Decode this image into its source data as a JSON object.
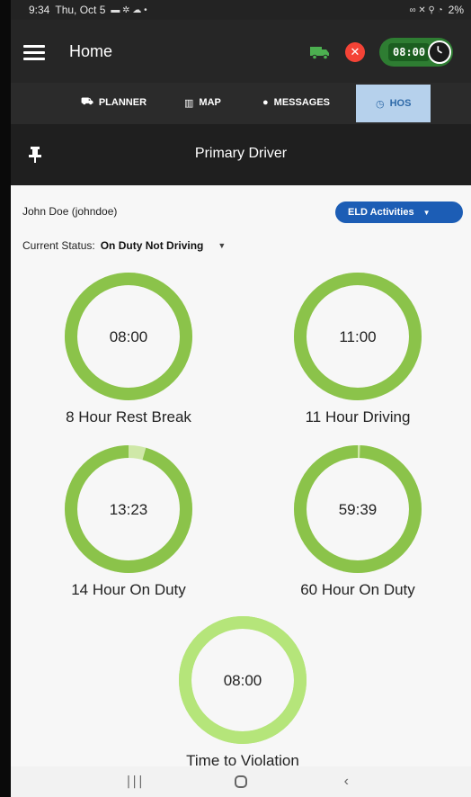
{
  "status_bar": {
    "time": "9:34",
    "date": "Thu, Oct 5",
    "battery": "2%"
  },
  "app_bar": {
    "title": "Home",
    "clock_time": "08:00"
  },
  "tabs": [
    {
      "label": "PLANNER",
      "icon": "truck-icon"
    },
    {
      "label": "MAP",
      "icon": "map-icon"
    },
    {
      "label": "MESSAGES",
      "icon": "chat-icon"
    },
    {
      "label": "HOS",
      "icon": "clock-icon",
      "active": true
    }
  ],
  "driver_bar": {
    "title": "Primary Driver"
  },
  "user": {
    "name": "John Doe",
    "username": "(johndoe)",
    "display": "John Doe  (johndoe)"
  },
  "eld_button": {
    "label": "ELD Activities"
  },
  "current_status": {
    "label": "Current Status:",
    "value": "On Duty Not Driving"
  },
  "gauges": [
    {
      "time": "08:00",
      "label": "8 Hour Rest Break",
      "remaining_fraction": 1.0
    },
    {
      "time": "11:00",
      "label": "11 Hour Driving",
      "remaining_fraction": 1.0
    },
    {
      "time": "13:23",
      "label": "14 Hour On Duty",
      "remaining_fraction": 0.956
    },
    {
      "time": "59:39",
      "label": "60 Hour On Duty",
      "remaining_fraction": 0.994
    },
    {
      "time": "08:00",
      "label": "Time to Violation",
      "remaining_fraction": 1.0
    }
  ],
  "colors": {
    "gauge_fill": "#8bc34a",
    "gauge_track": "#cfe8a8",
    "gauge_light": "#b5e57a",
    "accent_blue": "#1c5db5",
    "danger": "#f44336",
    "clock_green": "#2e7d32"
  }
}
